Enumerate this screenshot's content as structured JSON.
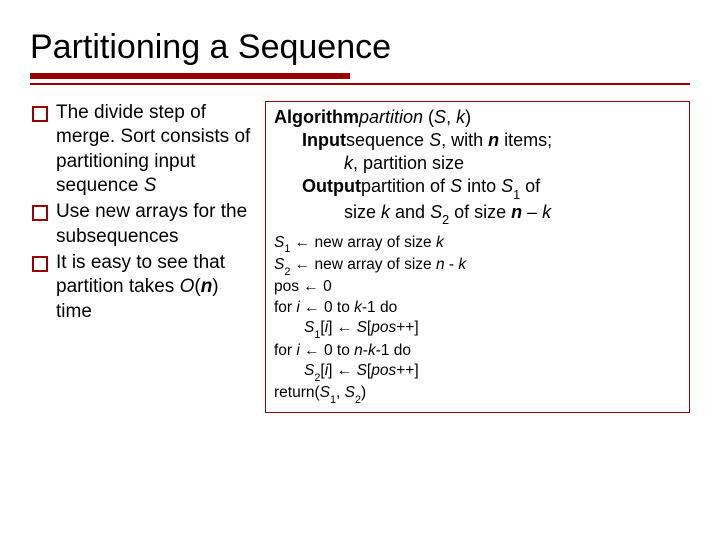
{
  "title": "Partitioning a Sequence",
  "bullets": {
    "b1a": "The divide step of merge. Sort consists of partitioning input sequence ",
    "b1s": "S",
    "b2": "Use new arrays for the subsequences",
    "b3a": "It is easy to see that partition takes ",
    "b3b": "O",
    "b3c": "(",
    "b3d": "n",
    "b3e": ") time"
  },
  "algo": {
    "headA": "Algorithm",
    "headB": "partition ",
    "headC": "(",
    "headD": "S",
    "headE": ", ",
    "headF": "k",
    "headG": ")",
    "inLabel": "Input",
    "in1a": "sequence ",
    "in1b": "S",
    "in1c": ", with ",
    "in1d": "n",
    "in1e": " items;",
    "in2a": "k",
    "in2b": ", partition size",
    "outLabel": "Output",
    "out1a": "partition of ",
    "out1b": "S",
    "out1c": " into ",
    "out1d": "S",
    "out1e": " of",
    "out2a": "size ",
    "out2b": "k",
    "out2c": " and ",
    "out2d": "S",
    "out2e": " of size ",
    "out2f": "n",
    "out2g": " – ",
    "out2h": "k"
  },
  "code": {
    "l1a": "S",
    "l1b": " ← new array of size ",
    "l1c": "k",
    "l2a": "S",
    "l2b": " ← new array of size ",
    "l2c": "n",
    "l2d": " - ",
    "l2e": "k",
    "l3": "pos ← 0",
    "l4a": "for",
    "l4b": " i ",
    "l4c": "←",
    "l4d": " 0 to",
    "l4e": " k",
    "l4f": "-1 ",
    "l4g": "do",
    "l5a": "S",
    "l5b": "[",
    "l5c": "i",
    "l5d": "] ← ",
    "l5e": "S",
    "l5f": "[",
    "l5g": "pos",
    "l5h": "++]",
    "l6a": "for",
    "l6b": " i ",
    "l6c": "←",
    "l6d": " 0 to",
    "l6e": " n",
    "l6f": "-",
    "l6g": "k",
    "l6h": "-1 ",
    "l6i": "do",
    "l7a": "S",
    "l7b": "[",
    "l7c": "i",
    "l7d": "] ← ",
    "l7e": "S",
    "l7f": "[",
    "l7g": "pos",
    "l7h": "++]",
    "l8a": "return(",
    "l8b": "S",
    "l8c": ", ",
    "l8d": "S",
    "l8e": ")"
  },
  "subs": {
    "one": "1",
    "two": "2"
  }
}
